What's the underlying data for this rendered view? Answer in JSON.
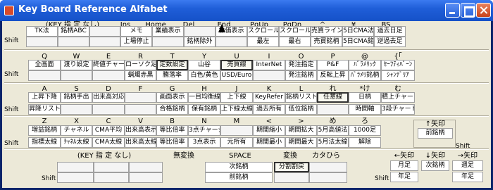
{
  "window": {
    "title": "Key Board Reference Alfabet"
  },
  "shift": "Shift",
  "cells": [
    {
      "id": "r1-h-0",
      "k": "t",
      "t": "(KEY 指 定 なし)"
    },
    {
      "id": "r1-h-1",
      "k": "t",
      "t": "Ins"
    },
    {
      "id": "r1-h-2",
      "k": "t",
      "t": "Home"
    },
    {
      "id": "r1-h-3",
      "k": "t",
      "t": "Del"
    },
    {
      "id": "r1-h-4",
      "k": "t",
      "t": "End"
    },
    {
      "id": "r1-h-5",
      "k": "t",
      "t": "PgUp"
    },
    {
      "id": "r1-h-6",
      "k": "t",
      "t": "PgDn"
    },
    {
      "id": "r1-h-7",
      "k": "t",
      "t": "^"
    },
    {
      "id": "r1-h-8",
      "k": "t",
      "t": "¥"
    },
    {
      "id": "r1-h-9",
      "k": "t",
      "t": "BS"
    },
    {
      "id": "r1-a-0",
      "k": "b",
      "t": "TK法"
    },
    {
      "id": "r1-a-1",
      "k": "b",
      "t": "銘柄ABC"
    },
    {
      "id": "r1-a-2",
      "k": "b",
      "t": ""
    },
    {
      "id": "r1-a-3",
      "k": "b",
      "t": "メモ"
    },
    {
      "id": "r1-a-4",
      "k": "b",
      "t": "業績表示"
    },
    {
      "id": "r1-a-5",
      "k": "b",
      "t": ""
    },
    {
      "id": "r1-a-6",
      "k": "b",
      "t": "株価表示"
    },
    {
      "id": "r1-a-7",
      "k": "b",
      "t": "スクロール左"
    },
    {
      "id": "r1-a-8",
      "k": "b",
      "t": "スクロール右"
    },
    {
      "id": "r1-a-9",
      "k": "b",
      "t": "売買ライン"
    },
    {
      "id": "r1-a-10",
      "k": "b",
      "t": "5日CMA法"
    },
    {
      "id": "r1-a-11",
      "k": "b",
      "t": "過去日足"
    },
    {
      "id": "r1-b-0",
      "k": "b",
      "t": ""
    },
    {
      "id": "r1-b-1",
      "k": "b",
      "t": ""
    },
    {
      "id": "r1-b-2",
      "k": "b",
      "t": ""
    },
    {
      "id": "r1-b-3",
      "k": "b",
      "t": "上場停止"
    },
    {
      "id": "r1-b-4",
      "k": "b",
      "t": ""
    },
    {
      "id": "r1-b-5",
      "k": "b",
      "t": "銘柄除外"
    },
    {
      "id": "r1-b-6",
      "k": "b",
      "t": ""
    },
    {
      "id": "r1-b-7",
      "k": "b",
      "t": "最左"
    },
    {
      "id": "r1-b-8",
      "k": "b",
      "t": "最右"
    },
    {
      "id": "r1-b-9",
      "k": "b",
      "t": "売買銘柄"
    },
    {
      "id": "r1-b-10",
      "k": "b",
      "t": "5日CMA銘"
    },
    {
      "id": "r1-b-11",
      "k": "b",
      "t": "逆過去足"
    },
    {
      "id": "r2-h-0",
      "k": "t",
      "t": "Q"
    },
    {
      "id": "r2-h-1",
      "k": "t",
      "t": "W"
    },
    {
      "id": "r2-h-2",
      "k": "t",
      "t": "E"
    },
    {
      "id": "r2-h-3",
      "k": "t",
      "t": "R"
    },
    {
      "id": "r2-h-4",
      "k": "t",
      "t": "T"
    },
    {
      "id": "r2-h-5",
      "k": "t",
      "t": "Y"
    },
    {
      "id": "r2-h-6",
      "k": "t",
      "t": "U"
    },
    {
      "id": "r2-h-7",
      "k": "t",
      "t": "I"
    },
    {
      "id": "r2-h-8",
      "k": "t",
      "t": "O"
    },
    {
      "id": "r2-h-9",
      "k": "t",
      "t": "P"
    },
    {
      "id": "r2-h-10",
      "k": "t",
      "t": "@"
    },
    {
      "id": "r2-h-11",
      "k": "t",
      "t": "{「"
    },
    {
      "id": "r2-a-0",
      "k": "b",
      "t": "全画面"
    },
    {
      "id": "r2-a-1",
      "k": "b",
      "t": "渡り設定"
    },
    {
      "id": "r2-a-2",
      "k": "b",
      "t": "終値チャート"
    },
    {
      "id": "r2-a-3",
      "k": "b",
      "t": "ローソク足"
    },
    {
      "id": "r2-a-4",
      "k": "b",
      "t": "定数設定"
    },
    {
      "id": "r2-a-5",
      "k": "b",
      "t": "山谷"
    },
    {
      "id": "r2-a-6",
      "k": "b",
      "t": "売買線"
    },
    {
      "id": "r2-a-7",
      "k": "b",
      "t": "InterNet"
    },
    {
      "id": "r2-a-8",
      "k": "b",
      "t": "発注指定"
    },
    {
      "id": "r2-a-9",
      "k": "b",
      "t": "P&F"
    },
    {
      "id": "r2-a-10",
      "k": "b",
      "t": "ﾊﾞﾗﾒﾘｯｸ"
    },
    {
      "id": "r2-a-11",
      "k": "b",
      "t": "ｾｰﾌﾃｨﾊﾞｰﾝ"
    },
    {
      "id": "r2-b-0",
      "k": "b",
      "t": ""
    },
    {
      "id": "r2-b-1",
      "k": "b",
      "t": ""
    },
    {
      "id": "r2-b-2",
      "k": "b",
      "t": ""
    },
    {
      "id": "r2-b-3",
      "k": "b",
      "t": "蝋燭赤黒"
    },
    {
      "id": "r2-b-4",
      "k": "b",
      "t": "騰落率"
    },
    {
      "id": "r2-b-5",
      "k": "b",
      "t": "白色/黄色"
    },
    {
      "id": "r2-b-6",
      "k": "b",
      "t": "USD/Euro"
    },
    {
      "id": "r2-b-7",
      "k": "b",
      "t": ""
    },
    {
      "id": "r2-b-8",
      "k": "b",
      "t": "発注銘柄"
    },
    {
      "id": "r2-b-9",
      "k": "b",
      "t": "反転上昇"
    },
    {
      "id": "r2-b-10",
      "k": "b",
      "t": "ﾊﾞﾗﾒﾘ銘柄"
    },
    {
      "id": "r2-b-11",
      "k": "b",
      "t": "ｼｬﾝﾃﾞﾘｱ"
    },
    {
      "id": "r3-h-0",
      "k": "t",
      "t": "A"
    },
    {
      "id": "r3-h-1",
      "k": "t",
      "t": "S"
    },
    {
      "id": "r3-h-2",
      "k": "t",
      "t": "D"
    },
    {
      "id": "r3-h-3",
      "k": "t",
      "t": "F"
    },
    {
      "id": "r3-h-4",
      "k": "t",
      "t": "G"
    },
    {
      "id": "r3-h-5",
      "k": "t",
      "t": "H"
    },
    {
      "id": "r3-h-6",
      "k": "t",
      "t": "J"
    },
    {
      "id": "r3-h-7",
      "k": "t",
      "t": "K"
    },
    {
      "id": "r3-h-8",
      "k": "t",
      "t": "L"
    },
    {
      "id": "r3-h-9",
      "k": "t",
      "t": "れ"
    },
    {
      "id": "r3-h-10",
      "k": "t",
      "t": "*け"
    },
    {
      "id": "r3-h-11",
      "k": "t",
      "t": "む"
    },
    {
      "id": "r3-a-0",
      "k": "b",
      "t": "上昇下降"
    },
    {
      "id": "r3-a-1",
      "k": "b",
      "t": "銘柄手出"
    },
    {
      "id": "r3-a-2",
      "k": "b",
      "t": "出来高対応"
    },
    {
      "id": "r3-a-3",
      "k": "b",
      "t": ""
    },
    {
      "id": "r3-a-4",
      "k": "b",
      "t": "画面表示"
    },
    {
      "id": "r3-a-5",
      "k": "b",
      "t": "一目均衡線"
    },
    {
      "id": "r3-a-6",
      "k": "b",
      "t": "上下線"
    },
    {
      "id": "r3-a-7",
      "k": "b",
      "t": "KeyRefer"
    },
    {
      "id": "r3-a-8",
      "k": "b",
      "t": "銘柄リスト"
    },
    {
      "id": "r3-a-9",
      "k": "b",
      "t": "任意線"
    },
    {
      "id": "r3-a-10",
      "k": "b",
      "t": "日柄"
    },
    {
      "id": "r3-a-11",
      "k": "b",
      "t": "積上チャート"
    },
    {
      "id": "r3-b-0",
      "k": "b",
      "t": "昇降リスト"
    },
    {
      "id": "r3-b-1",
      "k": "b",
      "t": ""
    },
    {
      "id": "r3-b-2",
      "k": "b",
      "t": ""
    },
    {
      "id": "r3-b-3",
      "k": "b",
      "t": ""
    },
    {
      "id": "r3-b-4",
      "k": "b",
      "t": "合格銘柄"
    },
    {
      "id": "r3-b-5",
      "k": "b",
      "t": "保有銘柄"
    },
    {
      "id": "r3-b-6",
      "k": "b",
      "t": "上下線太線"
    },
    {
      "id": "r3-b-7",
      "k": "b",
      "t": "過去所有"
    },
    {
      "id": "r3-b-8",
      "k": "b",
      "t": "低位銘柄"
    },
    {
      "id": "r3-b-9",
      "k": "b",
      "t": ""
    },
    {
      "id": "r3-b-10",
      "k": "b",
      "t": "時間軸"
    },
    {
      "id": "r3-b-11",
      "k": "b",
      "t": "3段チャート"
    },
    {
      "id": "r4-h-0",
      "k": "t",
      "t": "Z"
    },
    {
      "id": "r4-h-1",
      "k": "t",
      "t": "X"
    },
    {
      "id": "r4-h-2",
      "k": "t",
      "t": "C"
    },
    {
      "id": "r4-h-3",
      "k": "t",
      "t": "V"
    },
    {
      "id": "r4-h-4",
      "k": "t",
      "t": "B"
    },
    {
      "id": "r4-h-5",
      "k": "t",
      "t": "N"
    },
    {
      "id": "r4-h-6",
      "k": "t",
      "t": "M"
    },
    {
      "id": "r4-h-7",
      "k": "t",
      "t": "<"
    },
    {
      "id": "r4-h-8",
      "k": "t",
      "t": ">"
    },
    {
      "id": "r4-h-9",
      "k": "t",
      "t": "め"
    },
    {
      "id": "r4-h-10",
      "k": "t",
      "t": "ろ"
    },
    {
      "id": "r4-a-0",
      "k": "b",
      "t": "増益銘柄"
    },
    {
      "id": "r4-a-1",
      "k": "b",
      "t": "チャネル"
    },
    {
      "id": "r4-a-2",
      "k": "b",
      "t": "CMA平均"
    },
    {
      "id": "r4-a-3",
      "k": "b",
      "t": "出来高表示"
    },
    {
      "id": "r4-a-4",
      "k": "b",
      "t": "等比倍率"
    },
    {
      "id": "r4-a-5",
      "k": "b",
      "t": "3点チャージ"
    },
    {
      "id": "r4-a-6",
      "k": "b",
      "t": ""
    },
    {
      "id": "r4-a-7",
      "k": "b",
      "t": "期間縮小"
    },
    {
      "id": "r4-a-8",
      "k": "b",
      "t": "期間拡大"
    },
    {
      "id": "r4-a-9",
      "k": "b",
      "t": "5月高値法"
    },
    {
      "id": "r4-a-10",
      "k": "b",
      "t": "1000足"
    },
    {
      "id": "r4-b-0",
      "k": "b",
      "t": "指標太線"
    },
    {
      "id": "r4-b-1",
      "k": "b",
      "t": "ﾁｬﾈﾙ太線"
    },
    {
      "id": "r4-b-2",
      "k": "b",
      "t": "CMA太線"
    },
    {
      "id": "r4-b-3",
      "k": "b",
      "t": "出来高太線"
    },
    {
      "id": "r4-b-4",
      "k": "b",
      "t": "等比倍率"
    },
    {
      "id": "r4-b-5",
      "k": "b",
      "t": "3点表示"
    },
    {
      "id": "r4-b-6",
      "k": "b",
      "t": "元所有"
    },
    {
      "id": "r4-b-7",
      "k": "b",
      "t": "期間最小"
    },
    {
      "id": "r4-b-8",
      "k": "b",
      "t": "期間最大"
    },
    {
      "id": "r4-b-9",
      "k": "b",
      "t": "5月法太線"
    },
    {
      "id": "r4-b-10",
      "k": "b",
      "t": "解除"
    },
    {
      "id": "up-h",
      "k": "t",
      "t": "↑矢印"
    },
    {
      "id": "up-a",
      "k": "b",
      "t": "前銘柄"
    },
    {
      "id": "r5-h-0",
      "k": "t",
      "t": "(KEY 指 定 なし)"
    },
    {
      "id": "r5-h-1",
      "k": "t",
      "t": "無変換"
    },
    {
      "id": "r5-h-2",
      "k": "t",
      "t": "SPACE"
    },
    {
      "id": "r5-h-3",
      "k": "t",
      "t": "変換"
    },
    {
      "id": "r5-h-4",
      "k": "t",
      "t": "カタひら"
    },
    {
      "id": "r5-a-0",
      "k": "b",
      "t": ""
    },
    {
      "id": "r5-a-1",
      "k": "b",
      "t": ""
    },
    {
      "id": "r5-a-2",
      "k": "b",
      "t": ""
    },
    {
      "id": "r5-a-3",
      "k": "b",
      "t": "次銘柄"
    },
    {
      "id": "r5-a-4",
      "k": "b",
      "t": "分割割戻"
    },
    {
      "id": "r5-a-5",
      "k": "b",
      "t": ""
    },
    {
      "id": "r5-b-0",
      "k": "b",
      "t": ""
    },
    {
      "id": "r5-b-1",
      "k": "b",
      "t": ""
    },
    {
      "id": "r5-b-2",
      "k": "b",
      "t": ""
    },
    {
      "id": "r5-b-3",
      "k": "b",
      "t": "前銘柄"
    },
    {
      "id": "r5-b-4",
      "k": "b",
      "t": ""
    },
    {
      "id": "r5-b-5",
      "k": "b",
      "t": ""
    },
    {
      "id": "left-h",
      "k": "t",
      "t": "←矢印"
    },
    {
      "id": "down-h",
      "k": "t",
      "t": "↓矢印"
    },
    {
      "id": "right-h",
      "k": "t",
      "t": "→矢印"
    },
    {
      "id": "left-a",
      "k": "b",
      "t": "月足"
    },
    {
      "id": "down-a",
      "k": "b",
      "t": "次銘柄"
    },
    {
      "id": "right-a",
      "k": "b",
      "t": "週足"
    },
    {
      "id": "left-b",
      "k": "b",
      "t": "年足"
    },
    {
      "id": "right-b",
      "k": "b",
      "t": "年足"
    }
  ]
}
